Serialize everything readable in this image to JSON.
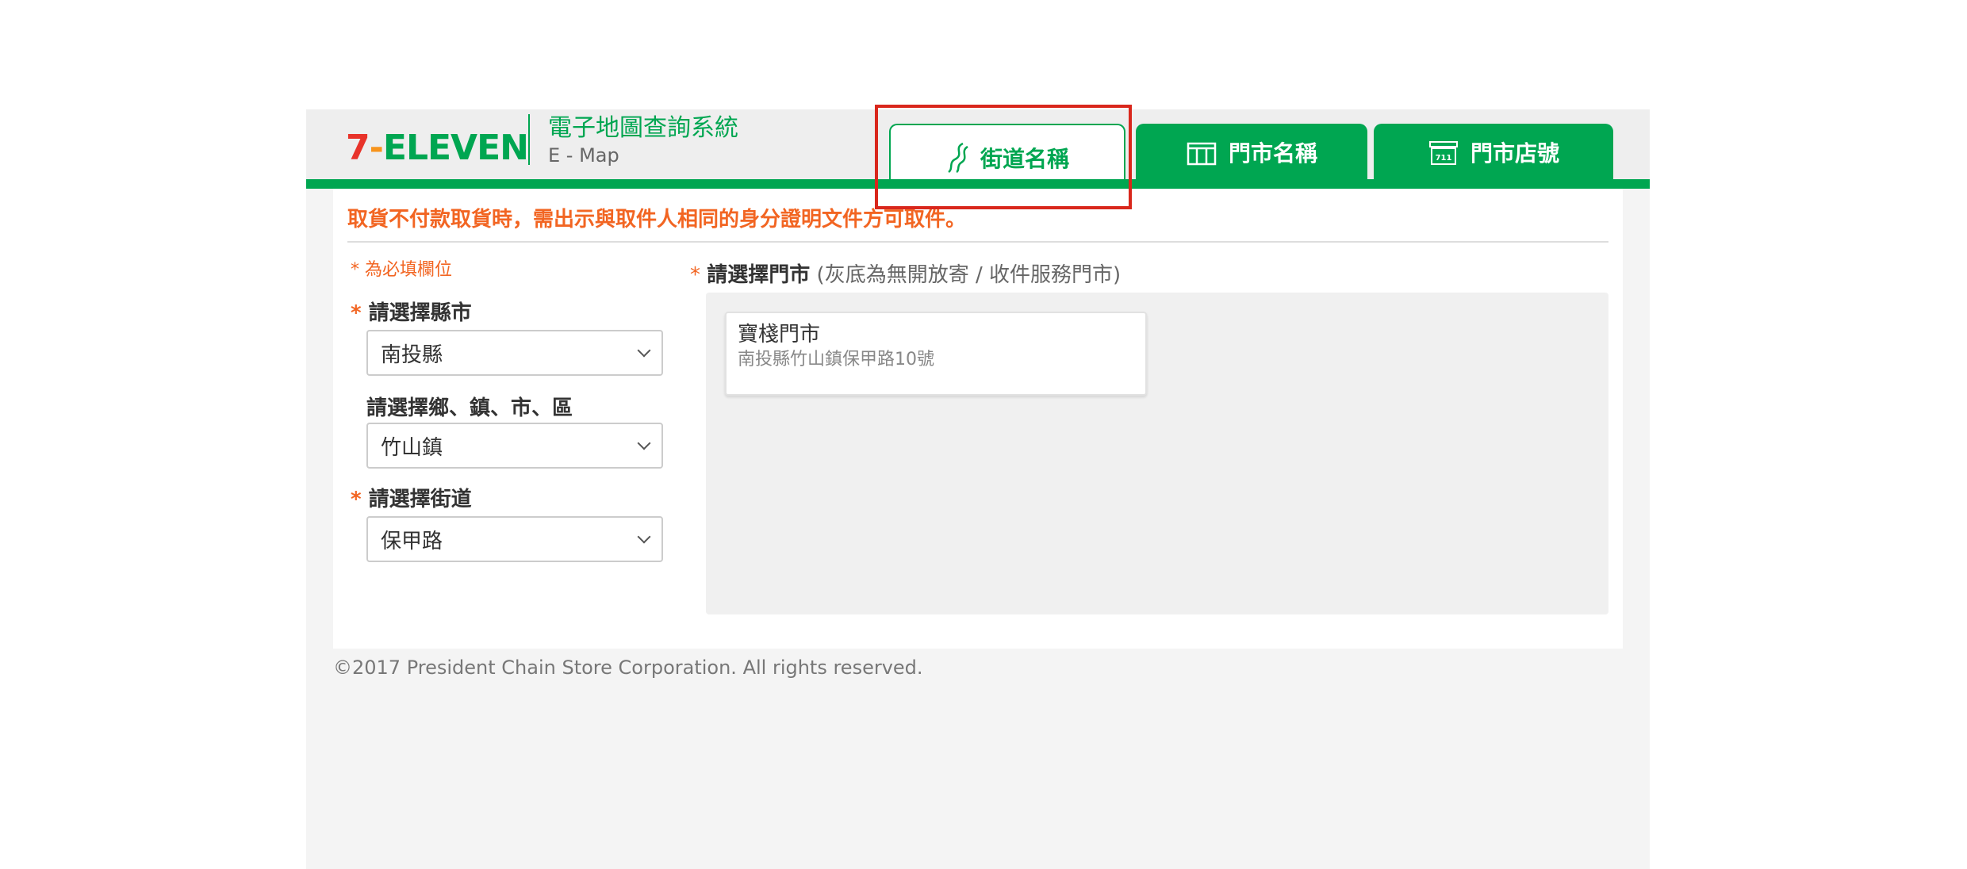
{
  "brand": {
    "logo_text": "7-ELEVEN",
    "system_title": "電子地圖查詢系統",
    "system_subtitle": "E - Map"
  },
  "tabs": [
    {
      "label": "街道名稱",
      "icon": "road-icon",
      "active": true
    },
    {
      "label": "門市名稱",
      "icon": "storefront-icon",
      "active": false
    },
    {
      "label": "門市店號",
      "icon": "store-number-icon",
      "active": false
    }
  ],
  "notice": "取貨不付款取貨時，需出示與取件人相同的身分證明文件方可取件。",
  "form": {
    "required_note": "* 為必填欄位",
    "required_mark": "*",
    "city": {
      "label": "請選擇縣市",
      "value": "南投縣"
    },
    "district": {
      "label": "請選擇鄉、鎮、市、區",
      "value": "竹山鎮"
    },
    "street": {
      "label": "請選擇街道",
      "value": "保甲路"
    }
  },
  "store_section": {
    "label": "請選擇門市",
    "hint": "(灰底為無開放寄 / 收件服務門市)",
    "stores": [
      {
        "name": "寶棧門市",
        "address": "南投縣竹山鎮保甲路10號"
      }
    ]
  },
  "footer": "©2017 President Chain Store Corporation. All rights reserved.",
  "colors": {
    "brand_green": "#00a651",
    "notice_orange": "#f26522",
    "highlight_red": "#d9271c"
  }
}
